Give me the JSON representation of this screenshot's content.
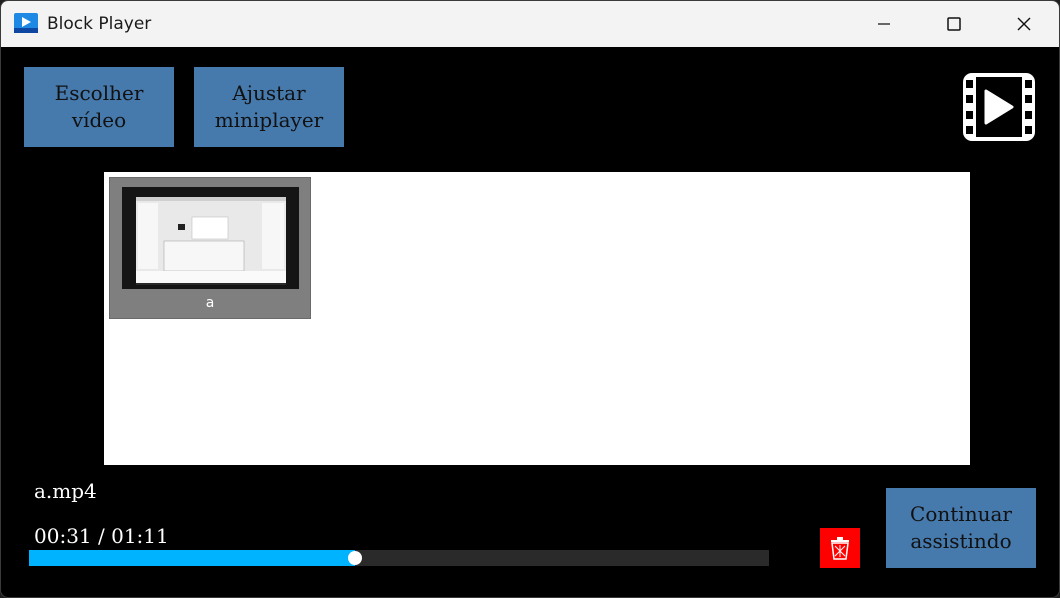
{
  "window": {
    "title": "Block Player"
  },
  "toolbar": {
    "choose_video_label": "Escolher\nvídeo",
    "adjust_miniplayer_label": "Ajustar\nminiplayer"
  },
  "video_list": [
    {
      "label": "a"
    }
  ],
  "player": {
    "filename": "a.mp4",
    "time": "00:31 / 01:11",
    "progress_fraction": 0.44,
    "continue_label": "Continuar\nassistindo"
  },
  "icons": {
    "app": "play-window-icon",
    "logo": "film-play-icon",
    "delete": "trash-icon"
  },
  "colors": {
    "button": "#4679ac",
    "progress": "#00b3ff",
    "delete": "#ff0000"
  }
}
